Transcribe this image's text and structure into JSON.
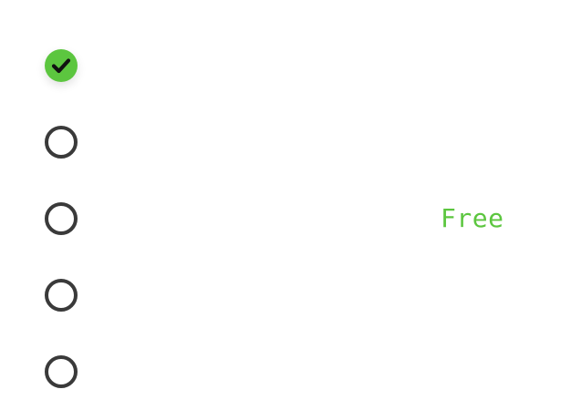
{
  "options": [
    {
      "selected": true,
      "price": ""
    },
    {
      "selected": false,
      "price": ""
    },
    {
      "selected": false,
      "price": "Free"
    },
    {
      "selected": false,
      "price": ""
    },
    {
      "selected": false,
      "price": ""
    }
  ],
  "colors": {
    "accent": "#5cc63f",
    "radio_border": "#3a3a3a",
    "check_mark": "#111111",
    "background": "#ffffff"
  },
  "icons": {
    "selected": "check-icon",
    "unselected": "radio-empty-icon"
  }
}
